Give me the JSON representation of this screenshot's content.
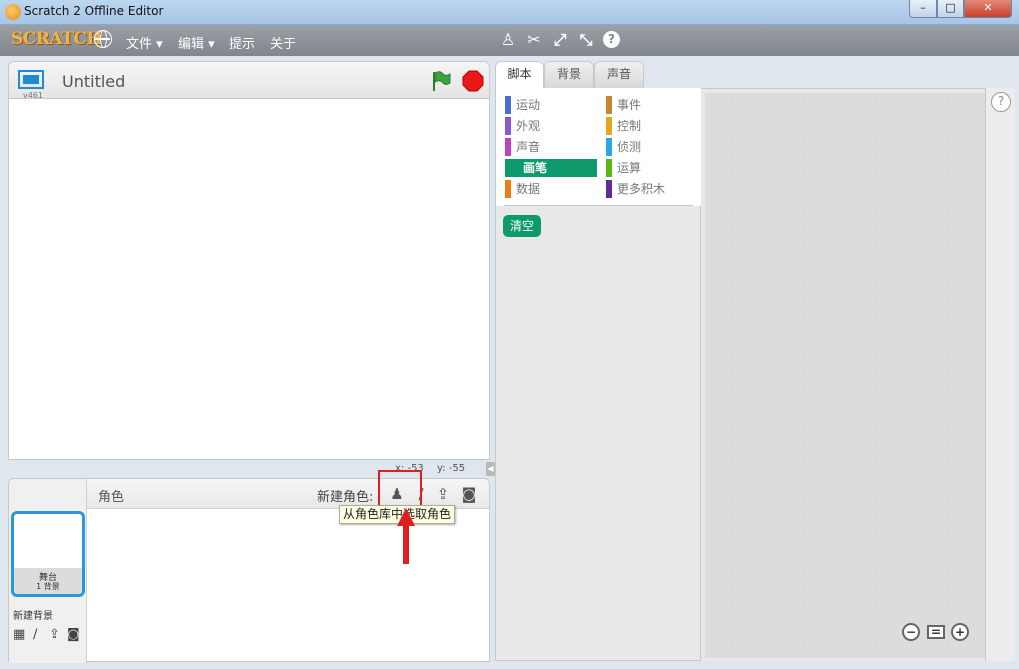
{
  "window": {
    "title": "Scratch 2 Offline Editor",
    "minimize": "–",
    "maximize": "□",
    "close": "✕"
  },
  "menubar": {
    "logo": "SCRATCH",
    "file": "文件 ▾",
    "edit": "编辑 ▾",
    "tips": "提示",
    "about": "关于",
    "tools": {
      "stamp": "♙",
      "cut": "✂",
      "grow": "⤢",
      "shrink": "⤡",
      "help": "?"
    }
  },
  "stage": {
    "version": "v461",
    "project_title": "Untitled",
    "coord_x": "x: -53",
    "coord_y": "y: -55",
    "collapse": "◀"
  },
  "sprite_panel": {
    "sprites_label": "角色",
    "new_sprite_label": "新建角色:",
    "stage_name": "舞台",
    "stage_backdrops": "1 背景",
    "new_backdrop_label": "新建背景",
    "icons": {
      "library": "♟",
      "paint": "∕",
      "upload": "⇪",
      "camera": "◙"
    },
    "tooltip": "从角色库中选取角色"
  },
  "tabs": {
    "scripts": "脚本",
    "backdrops": "背景",
    "sounds": "声音"
  },
  "categories": {
    "motion": {
      "label": "运动",
      "color": "#4a6cd4"
    },
    "looks": {
      "label": "外观",
      "color": "#8a55d7"
    },
    "sound": {
      "label": "声音",
      "color": "#bb42c3"
    },
    "pen": {
      "label": "画笔",
      "color": "#0e9a6c"
    },
    "data": {
      "label": "数据",
      "color": "#ee7d16"
    },
    "events": {
      "label": "事件",
      "color": "#c88330"
    },
    "control": {
      "label": "控制",
      "color": "#e1a91a"
    },
    "sensing": {
      "label": "侦测",
      "color": "#2ca5e2"
    },
    "operators": {
      "label": "运算",
      "color": "#5cb712"
    },
    "more": {
      "label": "更多积木",
      "color": "#632d99"
    }
  },
  "blocks": {
    "clear": "清空"
  },
  "zoom": {
    "out": "−",
    "reset": "=",
    "in": "+"
  },
  "help": "?"
}
